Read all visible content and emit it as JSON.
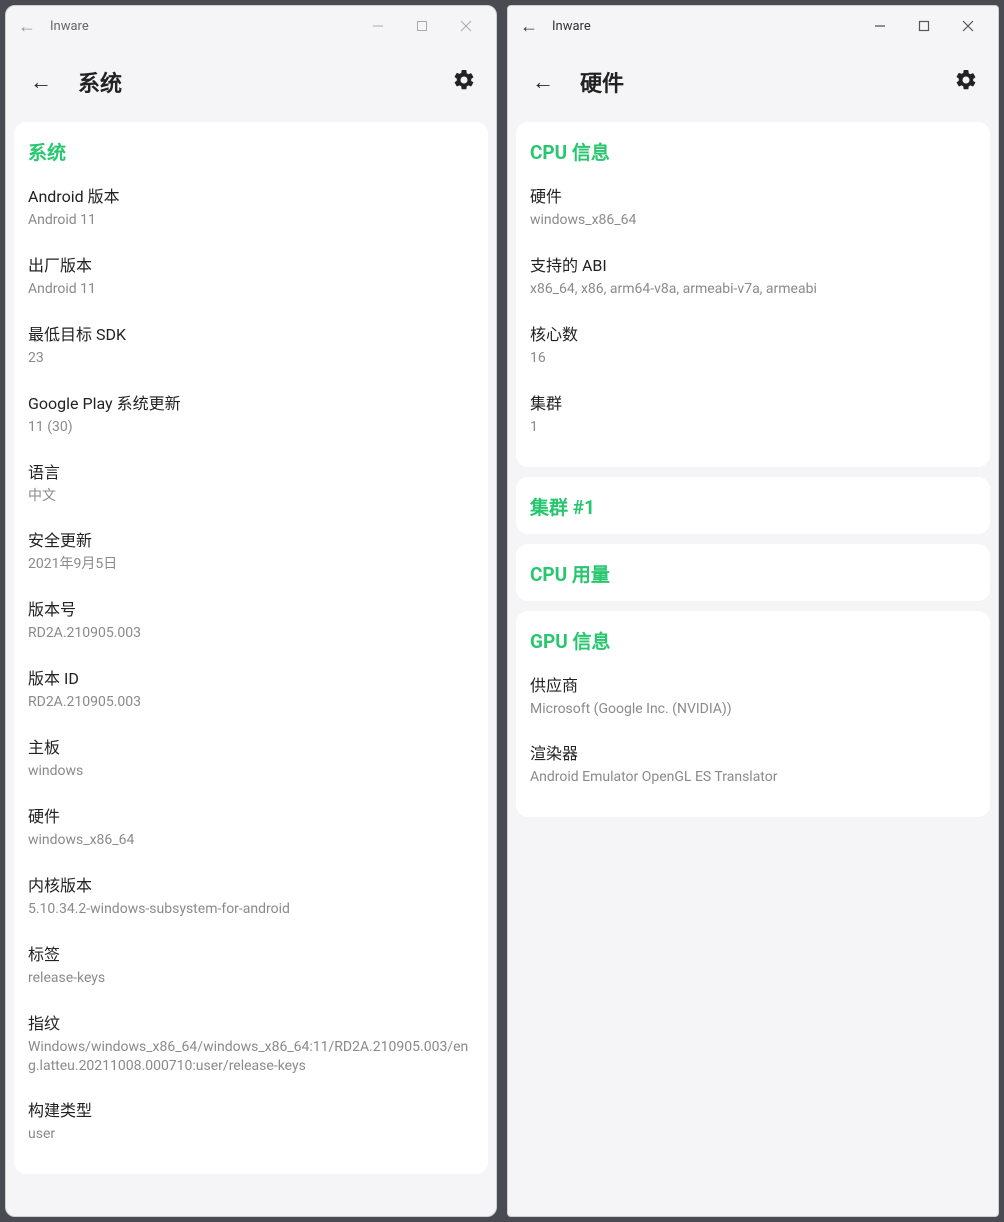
{
  "leftWindow": {
    "appTitle": "Inware",
    "pageTitle": "系统",
    "cards": [
      {
        "header": "系统",
        "items": [
          {
            "label": "Android 版本",
            "value": "Android 11"
          },
          {
            "label": "出厂版本",
            "value": "Android 11"
          },
          {
            "label": "最低目标 SDK",
            "value": "23"
          },
          {
            "label": "Google Play 系统更新",
            "value": "11 (30)"
          },
          {
            "label": "语言",
            "value": "中文"
          },
          {
            "label": "安全更新",
            "value": "2021年9月5日"
          },
          {
            "label": "版本号",
            "value": "RD2A.210905.003"
          },
          {
            "label": "版本 ID",
            "value": "RD2A.210905.003"
          },
          {
            "label": "主板",
            "value": "windows"
          },
          {
            "label": "硬件",
            "value": "windows_x86_64"
          },
          {
            "label": "内核版本",
            "value": "5.10.34.2-windows-subsystem-for-android"
          },
          {
            "label": "标签",
            "value": "release-keys"
          },
          {
            "label": "指纹",
            "value": "Windows/windows_x86_64/windows_x86_64:11/RD2A.210905.003/eng.latteu.20211008.000710:user/release-keys"
          },
          {
            "label": "构建类型",
            "value": "user"
          }
        ]
      }
    ]
  },
  "rightWindow": {
    "appTitle": "Inware",
    "pageTitle": "硬件",
    "cards": [
      {
        "header": "CPU 信息",
        "items": [
          {
            "label": "硬件",
            "value": "windows_x86_64"
          },
          {
            "label": "支持的 ABI",
            "value": "x86_64, x86, arm64-v8a, armeabi-v7a, armeabi"
          },
          {
            "label": "核心数",
            "value": "16"
          },
          {
            "label": "集群",
            "value": "1"
          }
        ]
      },
      {
        "header": "集群 #1",
        "items": []
      },
      {
        "header": "CPU 用量",
        "items": []
      },
      {
        "header": "GPU 信息",
        "items": [
          {
            "label": "供应商",
            "value": "Microsoft (Google Inc. (NVIDIA))"
          },
          {
            "label": "渲染器",
            "value": "Android Emulator OpenGL ES Translator"
          }
        ]
      }
    ]
  }
}
